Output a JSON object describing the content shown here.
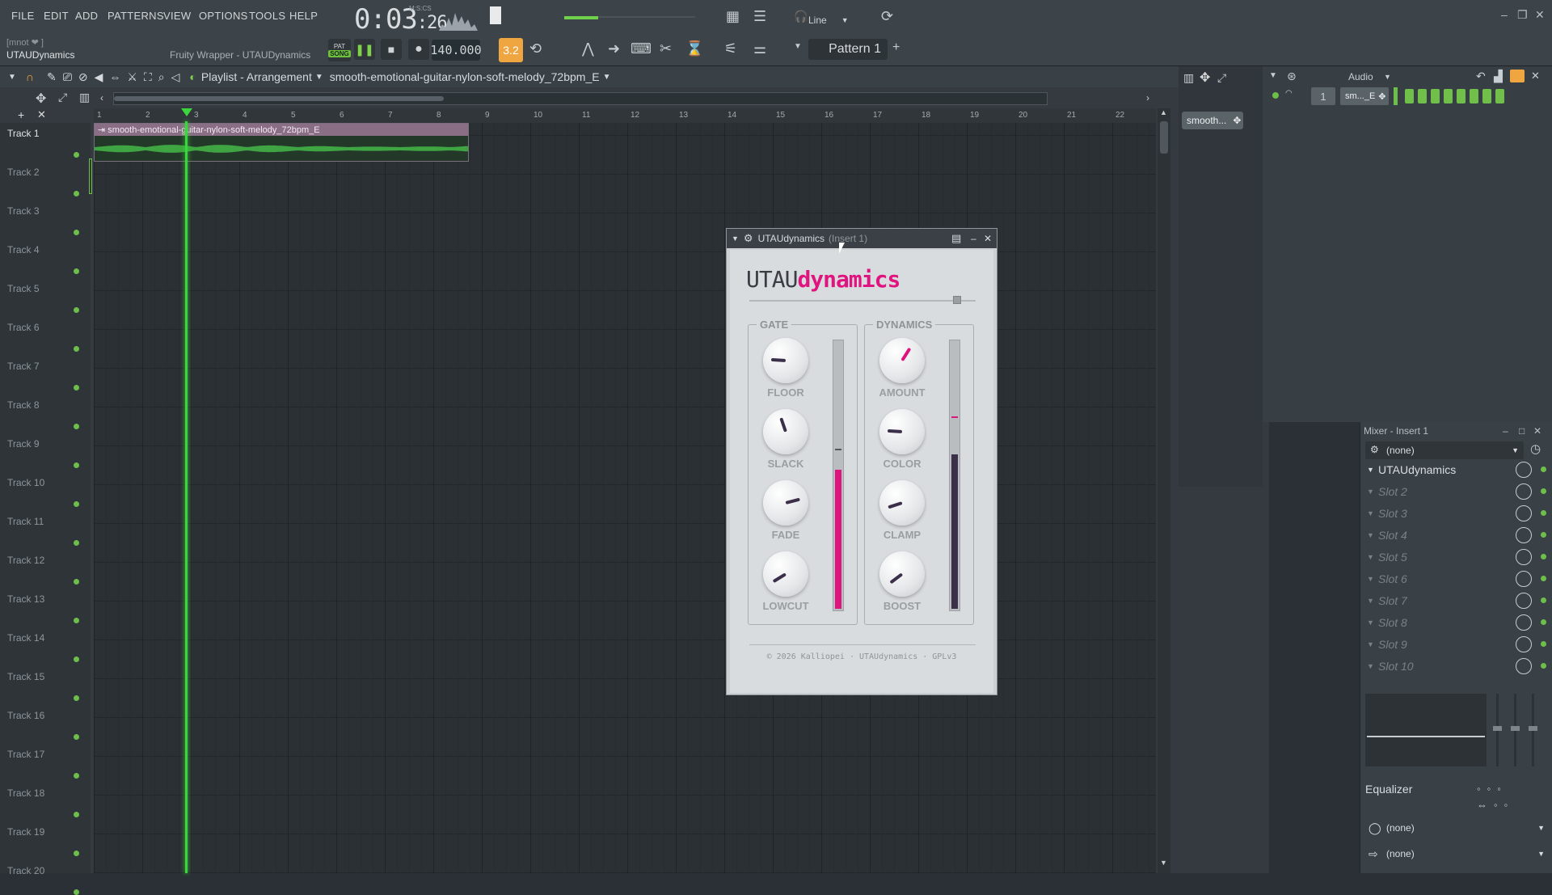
{
  "menu": [
    "FILE",
    "EDIT",
    "ADD",
    "PATTERNS",
    "VIEW",
    "OPTIONS",
    "TOOLS",
    "HELP"
  ],
  "hint": {
    "line1": "[mnot ❤ ]",
    "line2": "UTAUDynamics",
    "wrapper": "Fruity Wrapper - UTAUDynamics"
  },
  "transport": {
    "time_main": "0:03",
    "time_sub": ":26",
    "time_unit": "M:S:CS",
    "tempo": "140.000",
    "snap_label": "3.2",
    "pat_label": "PAT",
    "song_label": "SONG"
  },
  "toolbar": {
    "line_label": "Line",
    "pattern_label": "Pattern 1"
  },
  "playlist": {
    "title": "Playlist - Arrangement",
    "clip_name": "smooth-emotional-guitar-nylon-soft-melody_72bpm_E",
    "ruler": [
      "1",
      "2",
      "3",
      "4",
      "5",
      "6",
      "7",
      "8",
      "9",
      "10",
      "11",
      "12",
      "13",
      "14",
      "15",
      "16",
      "17",
      "18",
      "19",
      "20",
      "21",
      "22"
    ],
    "tracks": [
      "Track 1",
      "Track 2",
      "Track 3",
      "Track 4",
      "Track 5",
      "Track 6",
      "Track 7",
      "Track 8",
      "Track 9",
      "Track 10",
      "Track 11",
      "Track 12",
      "Track 13",
      "Track 14",
      "Track 15",
      "Track 16",
      "Track 17",
      "Track 18",
      "Track 19",
      "Track 20"
    ]
  },
  "channel_rack": {
    "audio_label": "Audio",
    "channel_short": "sm..._E",
    "channel_num": "1",
    "pick_label": "smooth..."
  },
  "plugin": {
    "window_title": "UTAUdynamics",
    "window_sub": "(Insert 1)",
    "logo_a": "UTAU",
    "logo_b": "dynamics",
    "gate": {
      "title": "GATE",
      "knobs": [
        {
          "label": "FLOOR",
          "value": 0.18
        },
        {
          "label": "SLACK",
          "value": 0.43
        },
        {
          "label": "FADE",
          "value": 0.78
        },
        {
          "label": "LOWCUT",
          "value": 0.05
        }
      ]
    },
    "dynamics": {
      "title": "DYNAMICS",
      "knobs": [
        {
          "label": "AMOUNT",
          "value": 0.62
        },
        {
          "label": "COLOR",
          "value": 0.18
        },
        {
          "label": "CLAMP",
          "value": 0.1
        },
        {
          "label": "BOOST",
          "value": 0.03
        }
      ]
    },
    "gate_meter": {
      "level": 0.52,
      "marker": 0.6,
      "color": "#e0147f"
    },
    "dynamics_meter": {
      "level": 0.58,
      "marker": 0.72,
      "color": "#3c2f4a"
    },
    "copyright": "© 2026 Kalliopei · UTAUdynamics · GPLv3",
    "accent": "#e0147f"
  },
  "mixer": {
    "title": "Mixer - Insert 1",
    "preset": "(none)",
    "slots": [
      "UTAUdynamics",
      "Slot 2",
      "Slot 3",
      "Slot 4",
      "Slot 5",
      "Slot 6",
      "Slot 7",
      "Slot 8",
      "Slot 9",
      "Slot 10"
    ],
    "eq_label": "Equalizer",
    "route_1": "(none)",
    "route_2": "(none)"
  }
}
